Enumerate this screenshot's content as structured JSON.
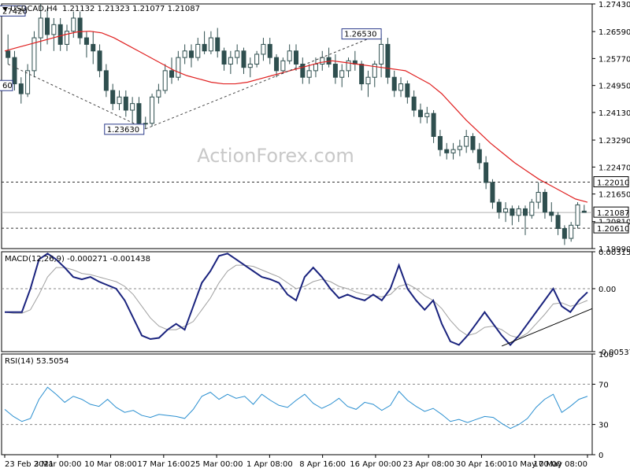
{
  "chart_data": {
    "type": "candlestick",
    "symbol_header": "USDCAD,H4",
    "ohlc_header": "1.21132 1.21323 1.21077 1.21087",
    "watermark": "ActionForex.com",
    "price_panel": {
      "ylim": [
        1.1999,
        1.2743
      ],
      "y_ticks": [
        "1.27430",
        "1.26590",
        "1.25770",
        "1.24950",
        "1.24130",
        "1.23290",
        "1.22470",
        "1.21650",
        "1.20810",
        "1.19990"
      ],
      "current_price": 1.21087,
      "current_label": "1.21087",
      "hlines": [
        {
          "value": 1.2201,
          "label": "1.22010"
        },
        {
          "value": 1.2061,
          "label": "1.20610"
        }
      ],
      "annotations": [
        {
          "label": "1.27420",
          "clipped_text": "27420",
          "value": 1.2742
        },
        {
          "label": "1.23630",
          "value": 1.2363
        },
        {
          "label": "1.26530",
          "value": 1.2653
        },
        {
          "label": "1.24960",
          "clipped_text": "60",
          "value": 1.2496
        }
      ],
      "candles": [
        [
          1.26,
          1.265,
          1.256,
          1.258
        ],
        [
          1.258,
          1.26,
          1.248,
          1.25
        ],
        [
          1.25,
          1.252,
          1.244,
          1.247
        ],
        [
          1.247,
          1.256,
          1.246,
          1.254
        ],
        [
          1.254,
          1.266,
          1.252,
          1.264
        ],
        [
          1.264,
          1.2742,
          1.26,
          1.27
        ],
        [
          1.27,
          1.273,
          1.262,
          1.265
        ],
        [
          1.265,
          1.27,
          1.26,
          1.268
        ],
        [
          1.268,
          1.27,
          1.26,
          1.262
        ],
        [
          1.262,
          1.268,
          1.26,
          1.266
        ],
        [
          1.266,
          1.272,
          1.264,
          1.27
        ],
        [
          1.27,
          1.272,
          1.262,
          1.264
        ],
        [
          1.264,
          1.266,
          1.258,
          1.262
        ],
        [
          1.262,
          1.266,
          1.256,
          1.26
        ],
        [
          1.26,
          1.262,
          1.252,
          1.254
        ],
        [
          1.254,
          1.256,
          1.246,
          1.248
        ],
        [
          1.248,
          1.25,
          1.242,
          1.244
        ],
        [
          1.244,
          1.248,
          1.242,
          1.246
        ],
        [
          1.246,
          1.248,
          1.24,
          1.242
        ],
        [
          1.242,
          1.246,
          1.238,
          1.244
        ],
        [
          1.244,
          1.246,
          1.237,
          1.238
        ],
        [
          1.238,
          1.24,
          1.2363,
          1.238
        ],
        [
          1.238,
          1.247,
          1.237,
          1.246
        ],
        [
          1.246,
          1.25,
          1.244,
          1.248
        ],
        [
          1.248,
          1.256,
          1.247,
          1.254
        ],
        [
          1.254,
          1.258,
          1.25,
          1.252
        ],
        [
          1.252,
          1.26,
          1.251,
          1.258
        ],
        [
          1.258,
          1.262,
          1.256,
          1.26
        ],
        [
          1.26,
          1.262,
          1.255,
          1.258
        ],
        [
          1.258,
          1.264,
          1.257,
          1.262
        ],
        [
          1.262,
          1.266,
          1.259,
          1.26
        ],
        [
          1.26,
          1.266,
          1.259,
          1.264
        ],
        [
          1.264,
          1.267,
          1.258,
          1.26
        ],
        [
          1.26,
          1.261,
          1.254,
          1.256
        ],
        [
          1.256,
          1.26,
          1.253,
          1.258
        ],
        [
          1.258,
          1.262,
          1.256,
          1.26
        ],
        [
          1.26,
          1.261,
          1.253,
          1.255
        ],
        [
          1.255,
          1.258,
          1.252,
          1.256
        ],
        [
          1.256,
          1.26,
          1.255,
          1.259
        ],
        [
          1.259,
          1.264,
          1.257,
          1.262
        ],
        [
          1.262,
          1.264,
          1.256,
          1.258
        ],
        [
          1.258,
          1.259,
          1.252,
          1.254
        ],
        [
          1.254,
          1.258,
          1.253,
          1.257
        ],
        [
          1.257,
          1.262,
          1.256,
          1.26
        ],
        [
          1.26,
          1.262,
          1.254,
          1.256
        ],
        [
          1.256,
          1.258,
          1.25,
          1.252
        ],
        [
          1.252,
          1.256,
          1.25,
          1.254
        ],
        [
          1.254,
          1.258,
          1.252,
          1.256
        ],
        [
          1.256,
          1.26,
          1.254,
          1.258
        ],
        [
          1.258,
          1.261,
          1.255,
          1.256
        ],
        [
          1.256,
          1.259,
          1.25,
          1.252
        ],
        [
          1.252,
          1.256,
          1.249,
          1.254
        ],
        [
          1.254,
          1.258,
          1.252,
          1.257
        ],
        [
          1.257,
          1.26,
          1.254,
          1.256
        ],
        [
          1.256,
          1.257,
          1.248,
          1.25
        ],
        [
          1.25,
          1.254,
          1.246,
          1.252
        ],
        [
          1.252,
          1.257,
          1.249,
          1.256
        ],
        [
          1.256,
          1.2653,
          1.252,
          1.262
        ],
        [
          1.262,
          1.264,
          1.25,
          1.252
        ],
        [
          1.252,
          1.254,
          1.246,
          1.248
        ],
        [
          1.248,
          1.252,
          1.246,
          1.25
        ],
        [
          1.25,
          1.251,
          1.244,
          1.246
        ],
        [
          1.246,
          1.248,
          1.24,
          1.242
        ],
        [
          1.242,
          1.244,
          1.238,
          1.24
        ],
        [
          1.24,
          1.243,
          1.238,
          1.241
        ],
        [
          1.241,
          1.242,
          1.232,
          1.234
        ],
        [
          1.234,
          1.236,
          1.228,
          1.23
        ],
        [
          1.23,
          1.232,
          1.227,
          1.229
        ],
        [
          1.229,
          1.232,
          1.227,
          1.23
        ],
        [
          1.23,
          1.233,
          1.228,
          1.231
        ],
        [
          1.231,
          1.236,
          1.229,
          1.234
        ],
        [
          1.234,
          1.235,
          1.229,
          1.23
        ],
        [
          1.23,
          1.232,
          1.224,
          1.226
        ],
        [
          1.226,
          1.228,
          1.218,
          1.22
        ],
        [
          1.22,
          1.221,
          1.212,
          1.214
        ],
        [
          1.214,
          1.215,
          1.209,
          1.211
        ],
        [
          1.211,
          1.214,
          1.208,
          1.212
        ],
        [
          1.212,
          1.213,
          1.207,
          1.21
        ],
        [
          1.21,
          1.213,
          1.208,
          1.212
        ],
        [
          1.212,
          1.213,
          1.204,
          1.21
        ],
        [
          1.21,
          1.215,
          1.209,
          1.214
        ],
        [
          1.214,
          1.2201,
          1.212,
          1.217
        ],
        [
          1.217,
          1.218,
          1.209,
          1.211
        ],
        [
          1.211,
          1.214,
          1.208,
          1.21
        ],
        [
          1.21,
          1.211,
          1.204,
          1.206
        ],
        [
          1.206,
          1.207,
          1.201,
          1.203
        ],
        [
          1.203,
          1.208,
          1.202,
          1.207
        ],
        [
          1.207,
          1.214,
          1.206,
          1.2132
        ],
        [
          1.2113,
          1.2132,
          1.2108,
          1.2109
        ]
      ],
      "ma": [
        1.26,
        1.261,
        1.262,
        1.263,
        1.264,
        1.265,
        1.2658,
        1.266,
        1.2655,
        1.264,
        1.262,
        1.26,
        1.258,
        1.256,
        1.254,
        1.2525,
        1.2515,
        1.2505,
        1.25,
        1.25,
        1.2505,
        1.2515,
        1.2525,
        1.2535,
        1.2545,
        1.2555,
        1.2565,
        1.257,
        1.2565,
        1.256,
        1.2555,
        1.255,
        1.2545,
        1.254,
        1.252,
        1.25,
        1.247,
        1.243,
        1.239,
        1.2355,
        1.232,
        1.229,
        1.226,
        1.2235,
        1.221,
        1.219,
        1.217,
        1.215,
        1.214
      ]
    },
    "macd_panel": {
      "label": "MACD(12,26,9) -0.000271 -0.001438",
      "ylim": [
        -0.005373,
        0.003153
      ],
      "y_ticks": [
        "0.003153",
        "0.00",
        "-0.005373"
      ],
      "macd": [
        -0.002,
        -0.002,
        -0.002,
        0.0,
        0.0025,
        0.003,
        0.0025,
        0.0018,
        0.001,
        0.0008,
        0.001,
        0.0006,
        0.0003,
        0.0,
        -0.001,
        -0.0025,
        -0.004,
        -0.0043,
        -0.0042,
        -0.0035,
        -0.003,
        -0.0035,
        -0.0015,
        0.0005,
        0.0015,
        0.0028,
        0.003,
        0.0025,
        0.002,
        0.0015,
        0.001,
        0.0008,
        0.0005,
        -0.0005,
        -0.001,
        0.001,
        0.0018,
        0.001,
        0.0,
        -0.0008,
        -0.0005,
        -0.0008,
        -0.001,
        -0.0005,
        -0.001,
        0.0,
        0.002,
        0.0,
        -0.001,
        -0.0018,
        -0.001,
        -0.003,
        -0.0045,
        -0.0048,
        -0.004,
        -0.003,
        -0.002,
        -0.003,
        -0.004,
        -0.0048,
        -0.004,
        -0.003,
        -0.002,
        -0.001,
        0.0,
        -0.0015,
        -0.002,
        -0.001,
        -0.0003
      ],
      "signal": [
        -0.002,
        -0.0021,
        -0.0021,
        -0.0018,
        -0.0005,
        0.001,
        0.0018,
        0.0018,
        0.0016,
        0.0013,
        0.0012,
        0.001,
        0.0008,
        0.0006,
        0.0002,
        -0.0005,
        -0.0015,
        -0.0025,
        -0.0032,
        -0.0035,
        -0.0035,
        -0.0032,
        -0.0028,
        -0.0018,
        -0.0008,
        0.0005,
        0.0015,
        0.002,
        0.002,
        0.0019,
        0.0016,
        0.0013,
        0.001,
        0.0005,
        0.0,
        0.0002,
        0.0006,
        0.0008,
        0.0006,
        0.0002,
        0.0,
        -0.0003,
        -0.0005,
        -0.0006,
        -0.0007,
        -0.0005,
        0.0002,
        0.0004,
        0.0,
        -0.0006,
        -0.001,
        -0.0017,
        -0.0027,
        -0.0035,
        -0.004,
        -0.0038,
        -0.0033,
        -0.0032,
        -0.0035,
        -0.004,
        -0.0042,
        -0.0038,
        -0.003,
        -0.0022,
        -0.0013,
        -0.0012,
        -0.0015,
        -0.0013,
        -0.001
      ]
    },
    "rsi_panel": {
      "label": "RSI(14) 53.5054",
      "ylim": [
        0,
        100
      ],
      "y_ticks": [
        "100",
        "70",
        "30",
        "0"
      ],
      "levels": [
        70,
        30
      ],
      "rsi": [
        45,
        38,
        33,
        36,
        55,
        67,
        60,
        52,
        58,
        55,
        50,
        48,
        55,
        47,
        42,
        44,
        39,
        37,
        40,
        39,
        38,
        36,
        45,
        58,
        62,
        55,
        60,
        56,
        58,
        50,
        60,
        54,
        49,
        47,
        54,
        60,
        51,
        46,
        50,
        56,
        48,
        45,
        52,
        50,
        44,
        49,
        63,
        54,
        48,
        43,
        46,
        40,
        33,
        35,
        32,
        35,
        38,
        37,
        31,
        26,
        30,
        36,
        47,
        55,
        60,
        42,
        48,
        55,
        58
      ],
      "current": 53.5054
    },
    "x_ticks": [
      "23 Feb 2021",
      "3 Mar 00:00",
      "10 Mar 08:00",
      "17 Mar 16:00",
      "25 Mar 00:00",
      "1 Apr 08:00",
      "8 Apr 16:00",
      "16 Apr 00:00",
      "23 Apr 08:00",
      "30 Apr 16:00",
      "10 May 00:00",
      "17 May 08:00"
    ]
  }
}
